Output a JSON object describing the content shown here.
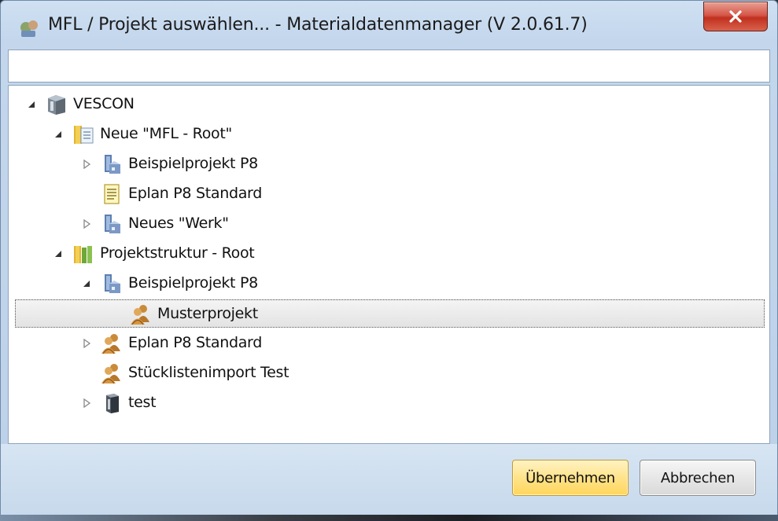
{
  "window": {
    "title": "MFL / Projekt auswählen... - Materialdatenmanager (V 2.0.61.7)",
    "close_icon": "close-icon"
  },
  "search": {
    "value": "",
    "placeholder": ""
  },
  "tree": {
    "nodes": [
      {
        "label": "VESCON",
        "level": 0,
        "expander": "expanded",
        "icon": "server-cube-icon"
      },
      {
        "label": "Neue \"MFL - Root\"",
        "level": 1,
        "expander": "expanded",
        "icon": "folder-document-icon"
      },
      {
        "label": "Beispielprojekt P8",
        "level": 2,
        "expander": "collapsed",
        "icon": "project-building-icon"
      },
      {
        "label": "Eplan P8 Standard",
        "level": 2,
        "expander": "none",
        "icon": "notepad-icon"
      },
      {
        "label": "Neues \"Werk\"",
        "level": 2,
        "expander": "collapsed",
        "icon": "project-building-icon"
      },
      {
        "label": "Projektstruktur - Root",
        "level": 1,
        "expander": "expanded",
        "icon": "folder-books-icon"
      },
      {
        "label": "Beispielprojekt P8",
        "level": 2,
        "expander": "expanded",
        "icon": "project-building-icon"
      },
      {
        "label": "Musterprojekt",
        "level": 3,
        "expander": "none",
        "icon": "users-icon",
        "selected": true
      },
      {
        "label": "Eplan P8 Standard",
        "level": 2,
        "expander": "collapsed",
        "icon": "users-icon"
      },
      {
        "label": "Stücklistenimport Test",
        "level": 2,
        "expander": "none",
        "icon": "users-icon"
      },
      {
        "label": "test",
        "level": 2,
        "expander": "collapsed",
        "icon": "server-cube-icon"
      }
    ]
  },
  "footer": {
    "accept_label": "Übernehmen",
    "cancel_label": "Abbrechen"
  },
  "colors": {
    "accent_button": "#ffd65c",
    "close_button": "#c0301f",
    "window_chrome": "#c3d6ec"
  }
}
